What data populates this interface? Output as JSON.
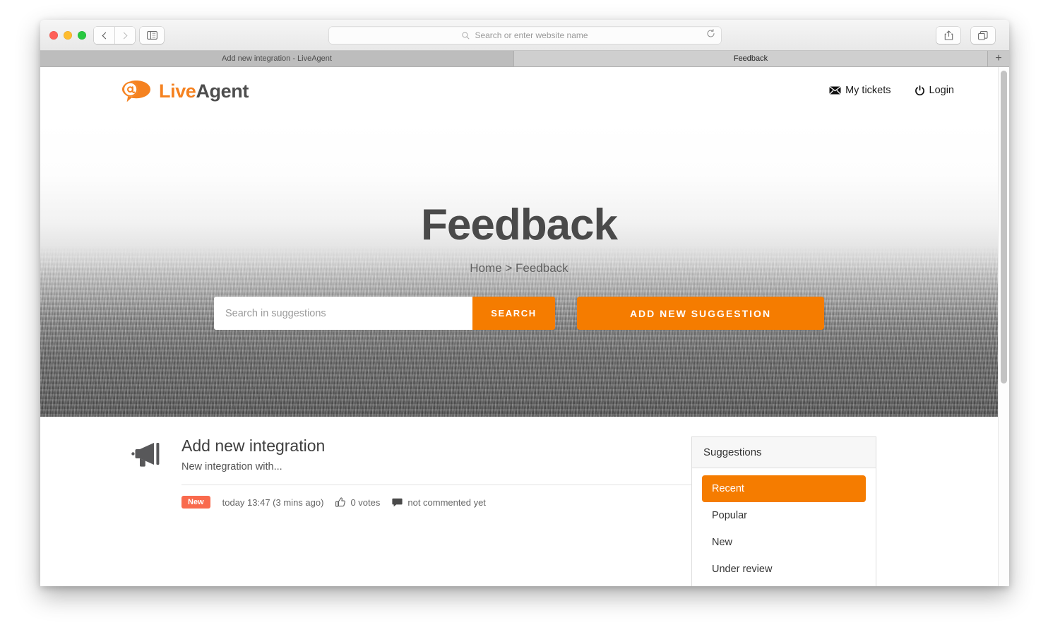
{
  "browser": {
    "window_controls": [
      "close",
      "minimize",
      "maximize"
    ],
    "nav": {
      "back_icon": "chevron-left-icon",
      "forward_icon": "chevron-right-icon",
      "sidebar_icon": "sidebar-toggle-icon"
    },
    "url_bar": {
      "placeholder": "Search or enter website name",
      "value": "",
      "search_icon": "search-icon",
      "reload_icon": "reload-icon"
    },
    "toolbar_right": {
      "share_icon": "share-icon",
      "tabs_icon": "tab-overview-icon"
    },
    "tabs": [
      {
        "title": "Add new integration - LiveAgent",
        "active": false
      },
      {
        "title": "Feedback",
        "active": true
      }
    ],
    "new_tab_label": "+"
  },
  "site_header": {
    "logo": {
      "live": "Live",
      "agent": "Agent",
      "mark_icon": "at-speech-bubble-icon"
    },
    "links": [
      {
        "label": "My tickets",
        "icon": "envelope-icon"
      },
      {
        "label": "Login",
        "icon": "power-icon"
      }
    ]
  },
  "hero": {
    "title": "Feedback",
    "breadcrumb": "Home > Feedback",
    "breadcrumb_parts": [
      "Home",
      ">",
      "Feedback"
    ],
    "search": {
      "placeholder": "Search in suggestions",
      "value": "",
      "button_label": "SEARCH"
    },
    "add_button_label": "ADD NEW SUGGESTION",
    "background": "grayscale-ocean-photo"
  },
  "suggestions": [
    {
      "icon": "megaphone-icon",
      "title": "Add new integration",
      "description": "New integration with...",
      "badge": "New",
      "timestamp": "today 13:47 (3 mins ago)",
      "votes": "0 votes",
      "votes_icon": "thumbs-up-icon",
      "comments": "not commented yet",
      "comments_icon": "comment-icon"
    }
  ],
  "panel": {
    "header": "Suggestions",
    "items": [
      {
        "label": "Recent",
        "active": true
      },
      {
        "label": "Popular",
        "active": false
      },
      {
        "label": "New",
        "active": false
      },
      {
        "label": "Under review",
        "active": false
      }
    ]
  },
  "colors": {
    "accent_orange": "#f57c00",
    "badge_orange": "#f96a4d",
    "logo_orange": "#f58220",
    "heading_gray": "#4a4a4a"
  }
}
